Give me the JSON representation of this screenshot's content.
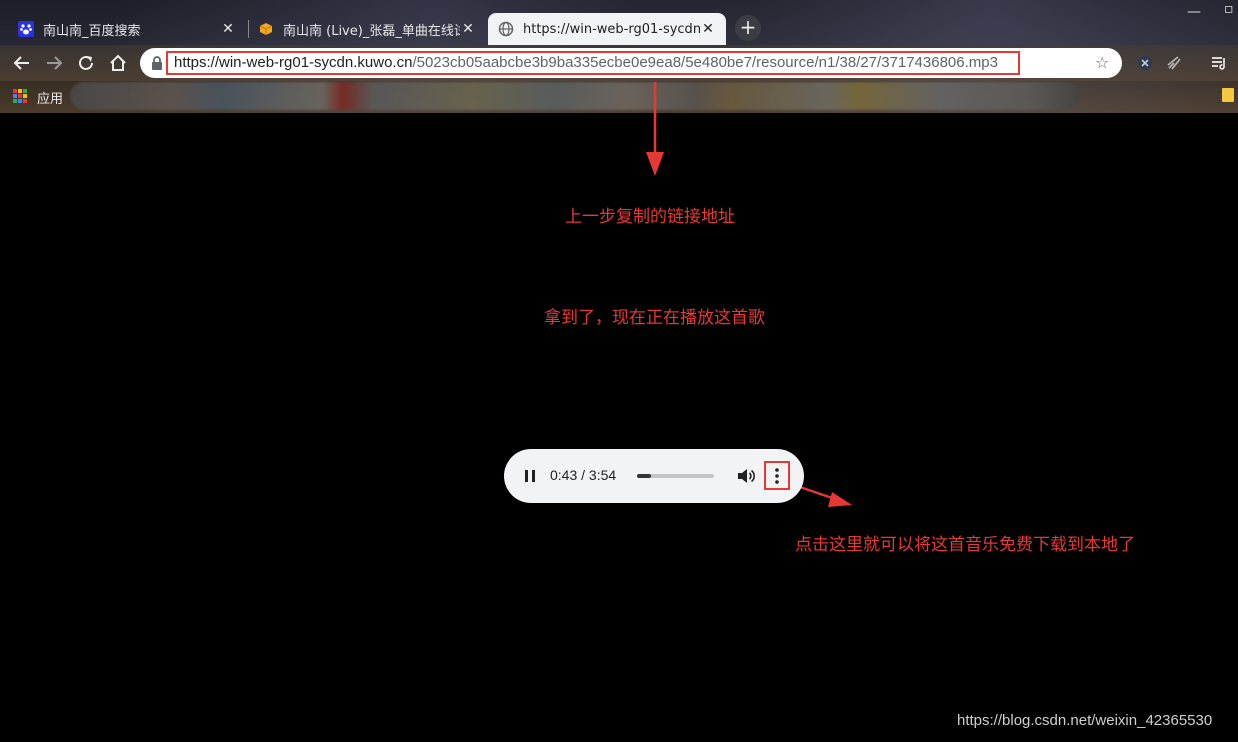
{
  "browser": {
    "tabs": [
      {
        "title": "南山南_百度搜索",
        "favicon": "baidu-paw-icon",
        "active": false
      },
      {
        "title": "南山南 (Live)_张磊_单曲在线试听",
        "favicon": "kuwo-icon",
        "active": false
      },
      {
        "title": "https://win-web-rg01-sycdn",
        "favicon": "globe-icon",
        "active": true
      }
    ],
    "new_tab_label": "+",
    "close_label": "✕",
    "url_host": "https://win-web-rg01-sycdn.kuwo.cn",
    "url_path": "/5023cb05aabcbe3b9ba335ecbe0e9ea8/5e480be7/resource/n1/38/27/3717436806.mp3",
    "bookmarks_apps_label": "应用"
  },
  "annotations": {
    "copied_link": "上一步复制的链接地址",
    "playing": "拿到了，现在正在播放这首歌",
    "download_hint": "点击这里就可以将这首音乐免费下载到本地了"
  },
  "player": {
    "time_display": "0:43 / 3:54",
    "progress_fraction": 0.18
  },
  "watermark": "https://blog.csdn.net/weixin_42365530",
  "colors": {
    "annotation_red": "#e53935",
    "player_bg": "#f1f3f4",
    "page_bg": "#000000"
  }
}
